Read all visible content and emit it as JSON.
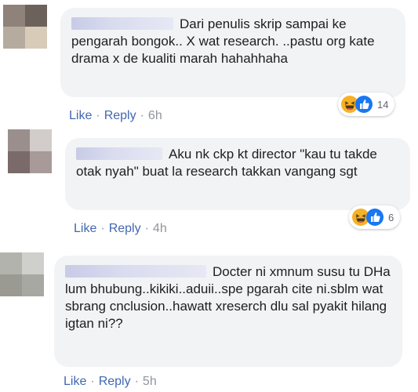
{
  "comments": [
    {
      "text": "Dari penulis skrip sampai ke pengarah bongok.. X wat research. ..pastu org kate drama x de kualiti marah hahahhaha",
      "like_label": "Like",
      "reply_label": "Reply",
      "time": "6h",
      "reaction_count": "14",
      "reaction_icons": [
        "haha-icon",
        "like-icon"
      ],
      "separator": "·"
    },
    {
      "text": "Aku nk ckp kt director \"kau tu takde otak nyah\" buat la research takkan vangang sgt",
      "like_label": "Like",
      "reply_label": "Reply",
      "time": "4h",
      "reaction_count": "6",
      "reaction_icons": [
        "haha-icon",
        "like-icon"
      ],
      "separator": "·"
    },
    {
      "text": "Docter ni xmnum susu tu DHa lum bhubung..kikiki..aduii..spe pgarah cite ni.sblm wat sbrang cnclusion..hawatt xreserch dlu sal pyakit hilang igtan ni??",
      "like_label": "Like",
      "reply_label": "Reply",
      "time": "5h",
      "separator": "·"
    }
  ],
  "colors": {
    "bubble": "#f2f3f5",
    "link": "#4267b2",
    "meta": "#90949c",
    "haha": "#f7b125",
    "like": "#1877f2"
  }
}
